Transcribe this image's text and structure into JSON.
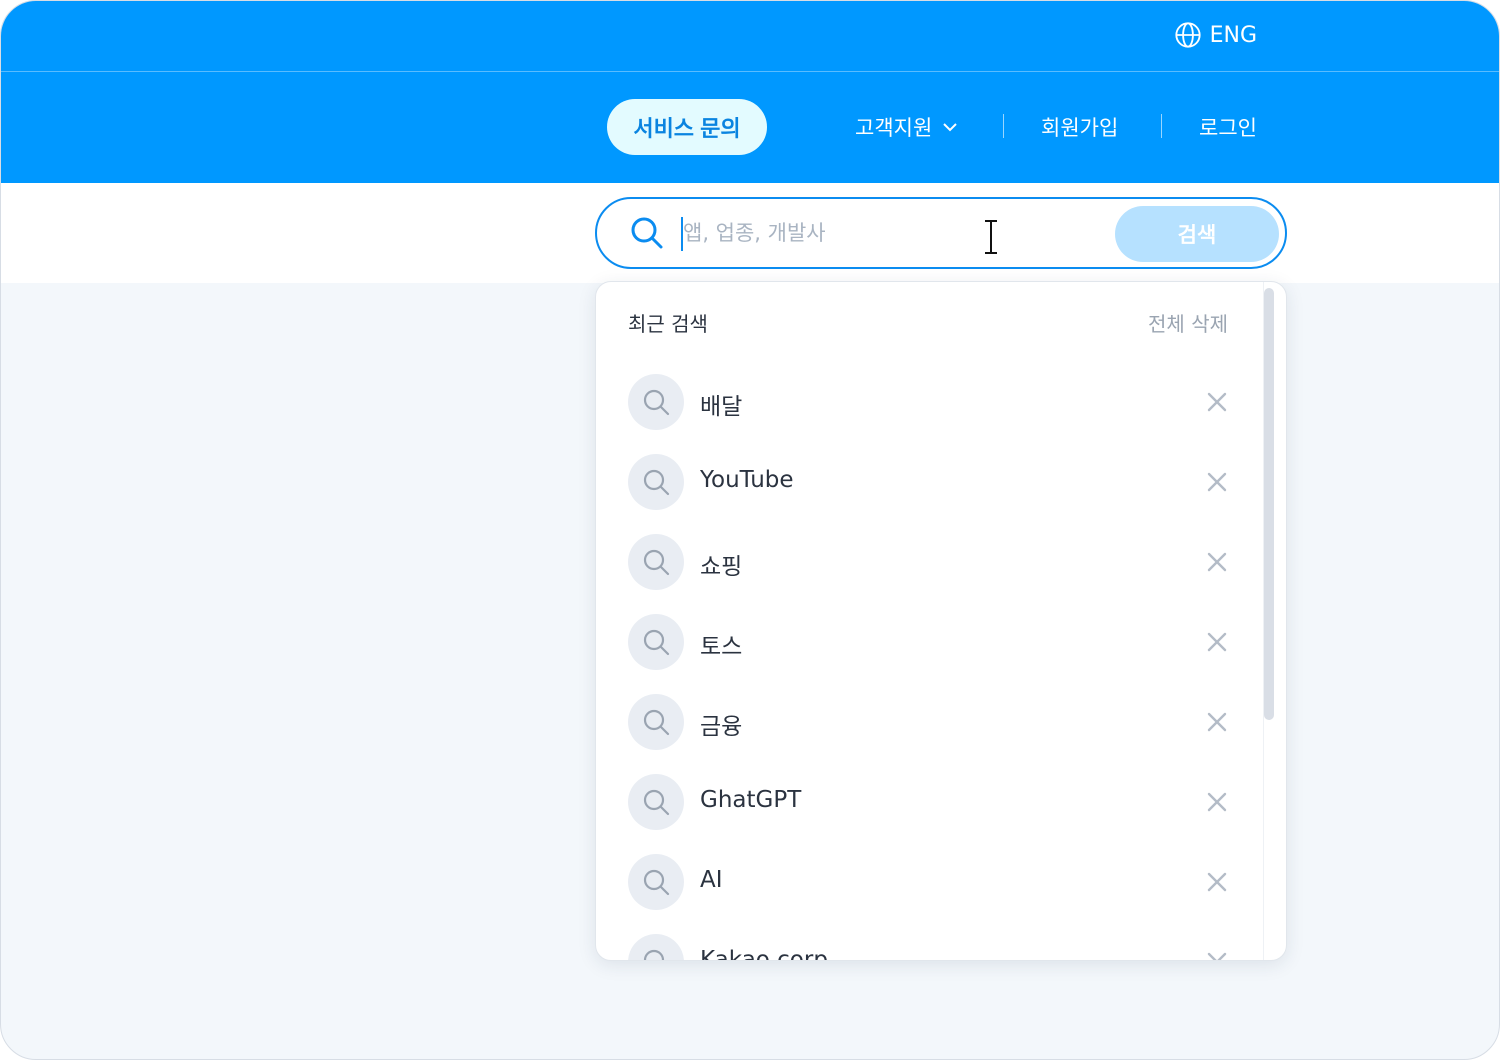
{
  "header": {
    "language": "ENG",
    "service_button": "서비스 문의",
    "nav": {
      "support": "고객지원",
      "signup": "회원가입",
      "login": "로그인"
    }
  },
  "search": {
    "placeholder": "앱, 업종, 개발사",
    "value": "",
    "button_label": "검색"
  },
  "recent": {
    "title": "최근 검색",
    "clear_all": "전체 삭제",
    "items": [
      {
        "label": "배달"
      },
      {
        "label": "YouTube"
      },
      {
        "label": "쇼핑"
      },
      {
        "label": "토스"
      },
      {
        "label": "금융"
      },
      {
        "label": "GhatGPT"
      },
      {
        "label": "AI"
      },
      {
        "label": "Kakao corp"
      }
    ]
  },
  "colors": {
    "brand": "#0098ff",
    "search_border": "#0b8cf0",
    "search_button": "#b6e1ff",
    "service_button_bg": "#e3fbff"
  }
}
